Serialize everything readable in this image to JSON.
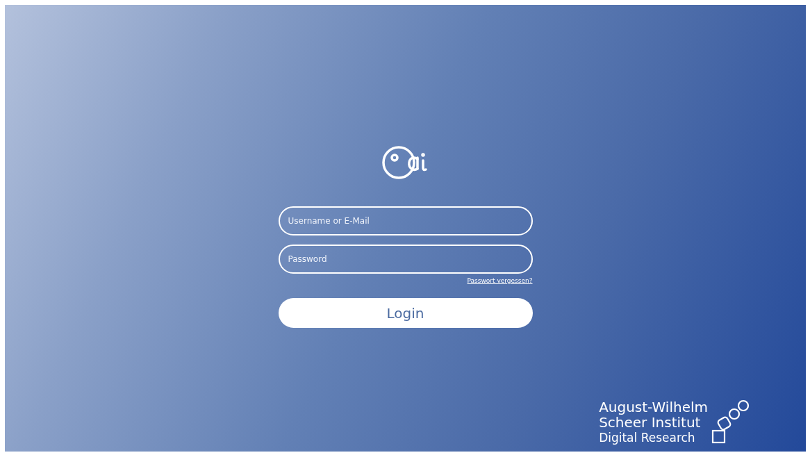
{
  "login_form": {
    "username": {
      "placeholder": "Username or E-Mail"
    },
    "password": {
      "placeholder": "Password"
    },
    "forgot_link": "Passwort vergessen?",
    "login_button": "Login"
  },
  "institute_logo": {
    "lines": [
      "August-Wilhelm",
      "Scheer Institut",
      "Digital Research"
    ]
  }
}
